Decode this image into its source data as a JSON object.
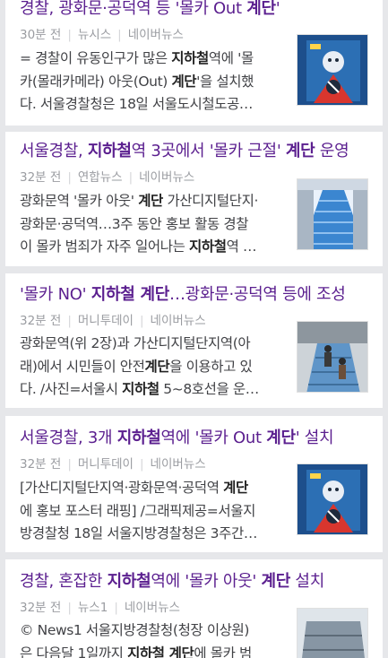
{
  "articles": [
    {
      "title_parts": [
        {
          "t": "경찰, 광화문·공덕역 등 '몰카 Out ",
          "b": false
        },
        {
          "t": "계단",
          "b": true
        },
        {
          "t": "'",
          "b": false
        }
      ],
      "time": "30분 전",
      "source": "뉴시스",
      "portal": "네이버뉴스",
      "snippet_lines": [
        [
          {
            "t": "= 경찰이 유동인구가 많은 ",
            "b": false
          },
          {
            "t": "지하철",
            "b": true
          },
          {
            "t": "역에 '몰",
            "b": false
          }
        ],
        [
          {
            "t": "카(몰래카메라) 아웃(Out) ",
            "b": false
          },
          {
            "t": "계단",
            "b": true
          },
          {
            "t": "'을 설치했",
            "b": false
          }
        ],
        [
          {
            "t": "다. 서울경찰청은 18일 서울도시철도공…",
            "b": false
          }
        ]
      ],
      "thumb": "poster-icon"
    },
    {
      "title_parts": [
        {
          "t": "서울경찰, ",
          "b": false
        },
        {
          "t": "지하철",
          "b": true
        },
        {
          "t": "역 3곳에서 '몰카 근절' ",
          "b": false
        },
        {
          "t": "계단",
          "b": true
        },
        {
          "t": " 운영",
          "b": false
        }
      ],
      "time": "32분 전",
      "source": "연합뉴스",
      "portal": "네이버뉴스",
      "snippet_lines": [
        [
          {
            "t": "광화문역 '몰카 아웃' ",
            "b": false
          },
          {
            "t": "계단",
            "b": true
          },
          {
            "t": " 가산디지털단지·",
            "b": false
          }
        ],
        [
          {
            "t": "광화문·공덕역…3주 동안 홍보 활동 경찰",
            "b": false
          }
        ],
        [
          {
            "t": "이 몰카 범죄가 자주 일어나는 ",
            "b": false
          },
          {
            "t": "지하철",
            "b": true
          },
          {
            "t": "역 …",
            "b": false
          }
        ]
      ],
      "thumb": "stairs-photo-icon"
    },
    {
      "title_parts": [
        {
          "t": "'몰카 NO' ",
          "b": false
        },
        {
          "t": "지하철 계단",
          "b": true
        },
        {
          "t": "…광화문·공덕역 등에 조성",
          "b": false
        }
      ],
      "time": "32분 전",
      "source": "머니투데이",
      "portal": "네이버뉴스",
      "snippet_lines": [
        [
          {
            "t": "광화문역(위 2장)과 가산디지털단지역(아",
            "b": false
          }
        ],
        [
          {
            "t": "래)에서 시민들이 안전",
            "b": false
          },
          {
            "t": "계단",
            "b": true
          },
          {
            "t": "을 이용하고 있",
            "b": false
          }
        ],
        [
          {
            "t": "다. /사진=서울시 ",
            "b": false
          },
          {
            "t": "지하철",
            "b": true
          },
          {
            "t": " 5~8호선을 운…",
            "b": false
          }
        ]
      ],
      "thumb": "stairs-people-icon"
    },
    {
      "title_parts": [
        {
          "t": "서울경찰, 3개 ",
          "b": false
        },
        {
          "t": "지하철",
          "b": true
        },
        {
          "t": "역에 '몰카 Out ",
          "b": false
        },
        {
          "t": "계단",
          "b": true
        },
        {
          "t": "' 설치",
          "b": false
        }
      ],
      "time": "32분 전",
      "source": "머니투데이",
      "portal": "네이버뉴스",
      "snippet_lines": [
        [
          {
            "t": "[가산디지털단지역·광화문역·공덕역 ",
            "b": false
          },
          {
            "t": "계단",
            "b": true
          }
        ],
        [
          {
            "t": "에 홍보 포스터 래핑] /그래픽제공=서울지",
            "b": false
          }
        ],
        [
          {
            "t": "방경찰청 18일 서울지방경찰청은 3주간…",
            "b": false
          }
        ]
      ],
      "thumb": "poster-icon"
    },
    {
      "title_parts": [
        {
          "t": "경찰, 혼잡한 ",
          "b": false
        },
        {
          "t": "지하철",
          "b": true
        },
        {
          "t": "역에 '몰카 아웃' ",
          "b": false
        },
        {
          "t": "계단",
          "b": true
        },
        {
          "t": " 설치",
          "b": false
        }
      ],
      "time": "32분 전",
      "source": "뉴스1",
      "portal": "네이버뉴스",
      "snippet_lines": [
        [
          {
            "t": "© News1 서울지방경찰청(청장 이상원)",
            "b": false
          }
        ],
        [
          {
            "t": "은 다음달 1일까지 ",
            "b": false
          },
          {
            "t": "지하철 계단",
            "b": true
          },
          {
            "t": "에 몰카 범",
            "b": false
          }
        ]
      ],
      "thumb": "stairs-photo-icon"
    }
  ],
  "colors": {
    "title": "#5b1f8f",
    "meta": "#9a9ca1",
    "snippet": "#414246",
    "background": "#e6e7ea"
  }
}
